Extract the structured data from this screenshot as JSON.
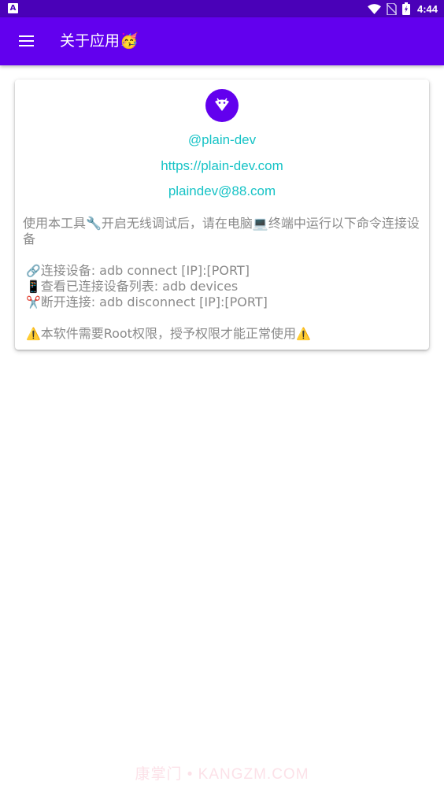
{
  "status_bar": {
    "left_icon": "A",
    "time": "4:44",
    "icons": [
      "wifi-icon",
      "no-sim-icon",
      "battery-icon"
    ]
  },
  "app_bar": {
    "menu_icon": "menu-icon",
    "title": "关于应用🥳"
  },
  "card": {
    "logo_icon": "android-robot-icon",
    "handle": "@plain-dev",
    "website": "https://plain-dev.com",
    "email": "plaindev@88.com",
    "description": "使用本工具🔧开启无线调试后，请在电脑💻终端中运行以下命令连接设备",
    "commands": [
      {
        "emoji": "🔗",
        "text": "连接设备: adb connect [IP]:[PORT]"
      },
      {
        "emoji": "📱",
        "text": "查看已连接设备列表: adb devices"
      },
      {
        "emoji": "✂️",
        "text": "断开连接: adb disconnect [IP]:[PORT]"
      }
    ],
    "warning": {
      "emoji": "⚠️",
      "text": "本软件需要Root权限，授予权限才能正常使用"
    }
  },
  "watermark": "康掌门 • KANGZM.COM",
  "colors": {
    "status_bar": "#4a01b8",
    "app_bar": "#6200ee",
    "link": "#17c3c6",
    "body_text": "#8a8a8a"
  }
}
